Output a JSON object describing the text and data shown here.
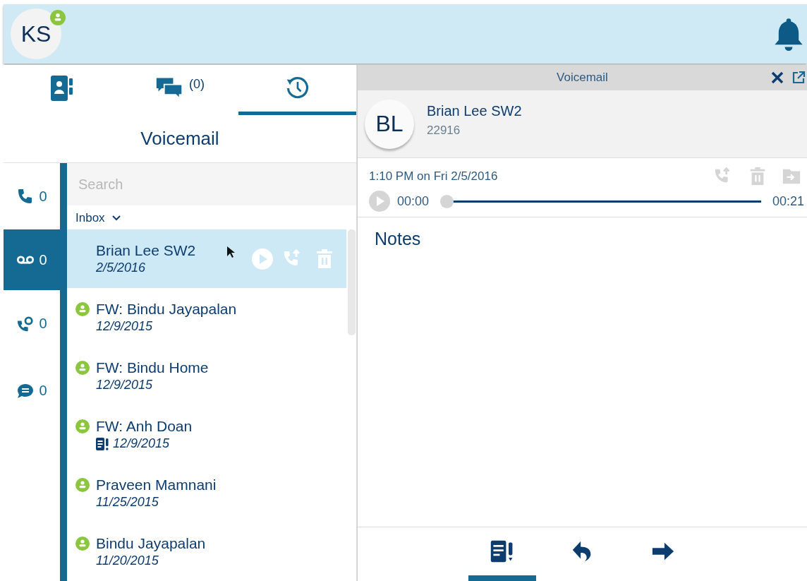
{
  "header": {
    "avatar_initials": "KS"
  },
  "tabs": [
    {
      "kind": "contacts",
      "selected": false
    },
    {
      "kind": "chat",
      "label": "(0)",
      "selected": false
    },
    {
      "kind": "history",
      "selected": true
    }
  ],
  "list_title": "Voicemail",
  "filters": [
    {
      "kind": "calls",
      "count": "0",
      "selected": false
    },
    {
      "kind": "voicemail",
      "count": "0",
      "selected": true
    },
    {
      "kind": "callback",
      "count": "0",
      "selected": false
    },
    {
      "kind": "chat",
      "count": "0",
      "selected": false
    }
  ],
  "search": {
    "placeholder": "Search"
  },
  "folder": "Inbox",
  "messages": [
    {
      "name": "Brian Lee SW2",
      "date": "2/5/2016",
      "selected": true,
      "presence": false,
      "has_note": false
    },
    {
      "name": "FW: Bindu Jayapalan",
      "date": "12/9/2015",
      "selected": false,
      "presence": true,
      "has_note": false
    },
    {
      "name": "FW: Bindu Home",
      "date": "12/9/2015",
      "selected": false,
      "presence": true,
      "has_note": false
    },
    {
      "name": "FW: Anh Doan",
      "date": "12/9/2015",
      "selected": false,
      "presence": true,
      "has_note": true
    },
    {
      "name": "Praveen Mamnani",
      "date": "11/25/2015",
      "selected": false,
      "presence": true,
      "has_note": false
    },
    {
      "name": "Bindu Jayapalan",
      "date": "11/20/2015",
      "selected": false,
      "presence": true,
      "has_note": false
    }
  ],
  "detail": {
    "title": "Voicemail",
    "contact": {
      "initials": "BL",
      "name": "Brian Lee SW2",
      "number": "22916"
    },
    "timestamp": "1:10 PM on Fri 2/5/2016",
    "player": {
      "elapsed": "00:00",
      "duration": "00:21",
      "level": 0
    },
    "notes_label": "Notes",
    "toolbar": [
      {
        "kind": "note",
        "selected": true
      },
      {
        "kind": "reply",
        "selected": false
      },
      {
        "kind": "forward",
        "selected": false
      }
    ]
  }
}
